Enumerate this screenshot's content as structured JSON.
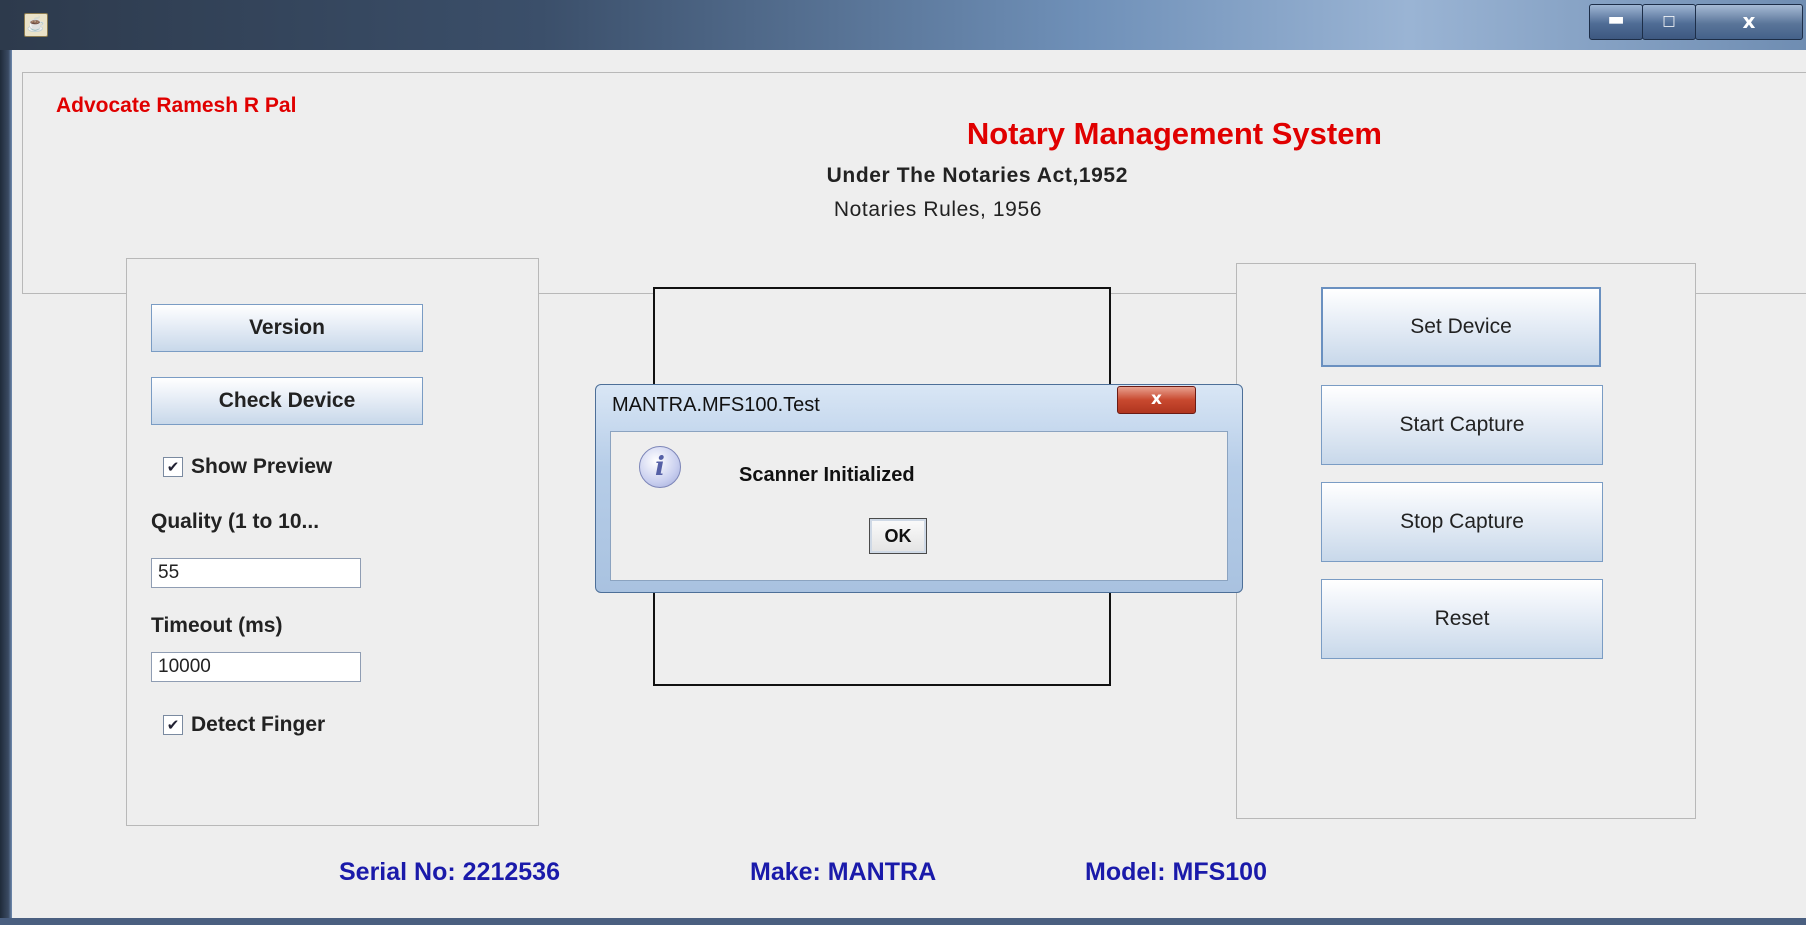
{
  "window": {
    "icon": "java-cup-icon",
    "min_label": "▬",
    "max_label": "□",
    "close_label": "x"
  },
  "header": {
    "advocate": "Advocate Ramesh R Pal",
    "title": "Notary Management System",
    "act": "Under The Notaries Act,1952",
    "rules": "Notaries Rules, 1956"
  },
  "left_panel": {
    "version_label": "Version",
    "check_device_label": "Check Device",
    "show_preview_label": "Show Preview",
    "show_preview_checked": true,
    "quality_label": "Quality (1 to 10...",
    "quality_value": "55",
    "timeout_label": "Timeout (ms)",
    "timeout_value": "10000",
    "detect_finger_label": "Detect Finger",
    "detect_finger_checked": true,
    "check_mark": "✔"
  },
  "right_panel": {
    "set_device_label": "Set Device",
    "start_capture_label": "Start Capture",
    "stop_capture_label": "Stop Capture",
    "reset_label": "Reset"
  },
  "footer": {
    "serial": "Serial No: 2212536",
    "make": "Make: MANTRA",
    "model": "Model: MFS100"
  },
  "dialog": {
    "title": "MANTRA.MFS100.Test",
    "close_label": "x",
    "icon": "info-icon",
    "icon_glyph": "i",
    "message": "Scanner Initialized",
    "ok_label": "OK"
  }
}
